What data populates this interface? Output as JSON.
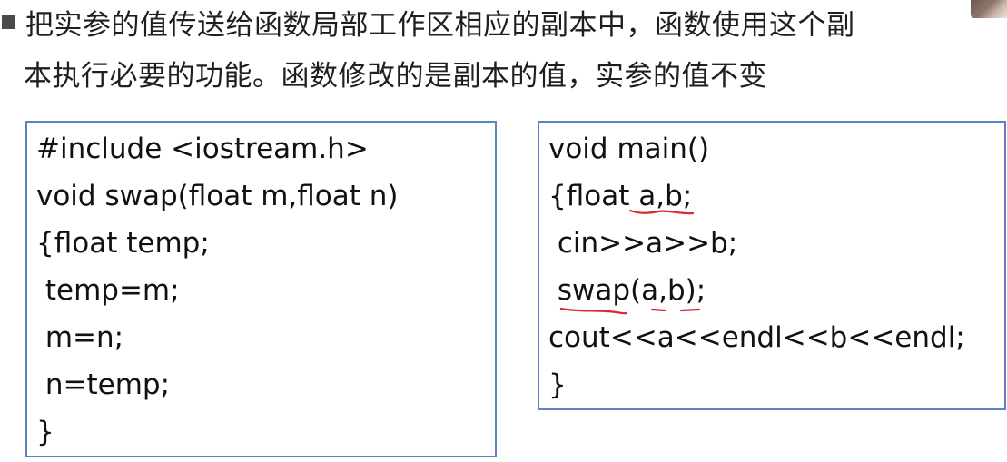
{
  "slide": {
    "paragraph": {
      "line1": "把实参的值传送给函数局部工作区相应的副本中，函数使用这个副",
      "line2": "本执行必要的功能。函数修改的是副本的值，实参的值不变"
    }
  },
  "left_code": {
    "lines": [
      "#include <iostream.h>",
      "void swap(float m,float n)",
      "{float temp;",
      " temp=m;",
      " m=n;",
      " n=temp;",
      "}"
    ]
  },
  "right_code": {
    "lines": [
      "void main()",
      "{float a,b;",
      " cin>>a>>b;",
      " swap(a,b);",
      "cout<<a<<endl<<b<<endl;",
      "}"
    ]
  },
  "colors": {
    "box_border": "#5b82c5",
    "annotation": "#d9272e",
    "bullet": "#4a4a4a"
  }
}
